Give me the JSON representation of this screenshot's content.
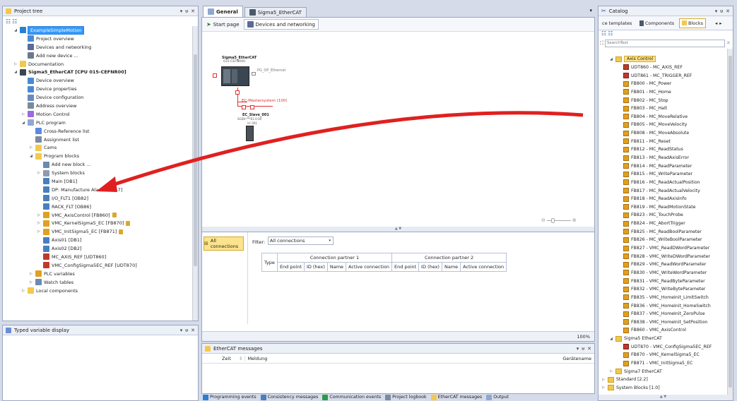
{
  "project_tree": {
    "title": "Project tree",
    "items": [
      {
        "label": "ExampleSimpleMotion",
        "level": 1,
        "icon": "project-icon",
        "selected": true,
        "arrow": "▲"
      },
      {
        "label": "Project overview",
        "level": 2,
        "icon": "overview-icon"
      },
      {
        "label": "Devices and networking",
        "level": 2,
        "icon": "network-icon"
      },
      {
        "label": "Add new device ...",
        "level": 2,
        "icon": "add-device-icon"
      },
      {
        "label": "Documentation",
        "level": 1,
        "icon": "documentation-icon",
        "arrow": "▷"
      },
      {
        "label": "Sigma5_EtherCAT [CPU 015-CEFNR00]",
        "level": 1,
        "icon": "cpu-icon",
        "bold": true,
        "arrow": "▲"
      },
      {
        "label": "Device overview",
        "level": 2,
        "icon": "overview-icon"
      },
      {
        "label": "Device properties",
        "level": 2,
        "icon": "properties-icon"
      },
      {
        "label": "Device configuration",
        "level": 2,
        "icon": "configuration-icon"
      },
      {
        "label": "Address overview",
        "level": 2,
        "icon": "address-icon"
      },
      {
        "label": "Motion Control",
        "level": 2,
        "icon": "motion-icon",
        "arrow": "▷"
      },
      {
        "label": "PLC program",
        "level": 2,
        "icon": "program-icon",
        "arrow": "▲"
      },
      {
        "label": "Cross-Reference list",
        "level": 3,
        "icon": "crossref-icon"
      },
      {
        "label": "Assignment list",
        "level": 3,
        "icon": "list-icon"
      },
      {
        "label": "Cams",
        "level": 3,
        "icon": "cams-icon",
        "arrow": "▷"
      },
      {
        "label": "Program blocks",
        "level": 3,
        "icon": "folder-icon",
        "arrow": "▲"
      },
      {
        "label": "Add new block ...",
        "level": 4,
        "icon": "add-block-icon"
      },
      {
        "label": "System blocks",
        "level": 4,
        "icon": "system-blocks-icon",
        "arrow": "▷"
      },
      {
        "label": "Main [OB1]",
        "level": 4,
        "icon": "ob-icon"
      },
      {
        "label": "DP: Manufacture Alarm [OB57]",
        "level": 4,
        "icon": "ob-icon"
      },
      {
        "label": "I/O_FLT1 [OB82]",
        "level": 4,
        "icon": "ob-icon"
      },
      {
        "label": "RACK_FLT [OB86]",
        "level": 4,
        "icon": "ob-icon"
      },
      {
        "label": "VMC_AxisControl [FB860]",
        "level": 4,
        "icon": "fb-icon",
        "arrow": "▷",
        "lock": true
      },
      {
        "label": "VMC_KernelSigma5_EC [FB870]",
        "level": 4,
        "icon": "fb-icon",
        "arrow": "▷",
        "lock": true
      },
      {
        "label": "VMC_InitSigma5_EC [FB871]",
        "level": 4,
        "icon": "fb-icon",
        "arrow": "▷",
        "lock": true
      },
      {
        "label": "Axis01 [DB1]",
        "level": 4,
        "icon": "db-icon"
      },
      {
        "label": "Axis02 [DB2]",
        "level": 4,
        "icon": "db-icon"
      },
      {
        "label": "MC_AXIS_REF [UDT860]",
        "level": 4,
        "icon": "udt-icon"
      },
      {
        "label": "VMC_ConfigSigma5EC_REF [UDT870]",
        "level": 4,
        "icon": "udt-icon"
      },
      {
        "label": "PLC variables",
        "level": 3,
        "icon": "variables-icon",
        "arrow": "▷"
      },
      {
        "label": "Watch tables",
        "level": 3,
        "icon": "watch-icon",
        "arrow": "▷"
      },
      {
        "label": "Local components",
        "level": 2,
        "icon": "folder-icon",
        "arrow": "▷"
      }
    ]
  },
  "typed_variable": {
    "title": "Typed variable display"
  },
  "editor": {
    "tabs": [
      {
        "label": "General",
        "active": true,
        "icon": "general-icon"
      },
      {
        "label": "Sigma5_EtherCAT",
        "active": false,
        "icon": "device-tab-icon"
      }
    ],
    "subtabs": [
      {
        "label": "Start page",
        "icon": "start-icon"
      },
      {
        "label": "Devices and networking",
        "icon": "network-icon"
      }
    ],
    "device": {
      "name": "Sigma5_EtherCAT",
      "cpu": "015-CEFNR00",
      "port": "PG_OP_Ethernet"
    },
    "master": "EC-Mastersystem (100)",
    "slave": {
      "name": "EC_Slave_001",
      "type": "SGDV-***E1-0-00",
      "id": "id: 001"
    }
  },
  "connections": {
    "button": "All connections",
    "filter_label": "Filter:",
    "filter_value": "All connections",
    "type_header": "Type",
    "partner1": "Connection partner 1",
    "partner2": "Connection partner 2",
    "columns": [
      "End point",
      "ID (hex)",
      "Name",
      "Active connection",
      "End point",
      "ID (hex)",
      "Name",
      "Active connection"
    ],
    "zoom": "100%"
  },
  "ethercat": {
    "title": "EtherCAT messages",
    "col_time": "Zeit",
    "col_message": "Meldung",
    "col_device": "Gerätename"
  },
  "bottom_tabs": [
    {
      "label": "Programming events",
      "icon": "programming-events-icon"
    },
    {
      "label": "Consistency messages",
      "icon": "consistency-icon"
    },
    {
      "label": "Communication events",
      "icon": "communication-icon"
    },
    {
      "label": "Project logbook",
      "icon": "logbook-icon"
    },
    {
      "label": "EtherCAT messages",
      "icon": "ethercat-icon"
    },
    {
      "label": "Output",
      "icon": "output-icon"
    }
  ],
  "catalog": {
    "title": "Catalog",
    "tabs": [
      {
        "label": "ce templates",
        "active": false
      },
      {
        "label": "Components",
        "active": false
      },
      {
        "label": "Blocks",
        "active": true
      }
    ],
    "search_placeholder": "SearchText",
    "items": [
      {
        "label": "Axis Control",
        "level": 1,
        "type": "folder",
        "selected": true,
        "arrow": "▲"
      },
      {
        "label": "UDT860 - MC_AXIS_REF",
        "level": 2,
        "type": "udt"
      },
      {
        "label": "UDT861 - MC_TRIGGER_REF",
        "level": 2,
        "type": "udt"
      },
      {
        "label": "FB800 - MC_Power",
        "level": 2,
        "type": "fb"
      },
      {
        "label": "FB801 - MC_Home",
        "level": 2,
        "type": "fb"
      },
      {
        "label": "FB802 - MC_Stop",
        "level": 2,
        "type": "fb"
      },
      {
        "label": "FB803 - MC_Halt",
        "level": 2,
        "type": "fb"
      },
      {
        "label": "FB804 - MC_MoveRelative",
        "level": 2,
        "type": "fb"
      },
      {
        "label": "FB805 - MC_MoveVelocity",
        "level": 2,
        "type": "fb"
      },
      {
        "label": "FB808 - MC_MoveAbsolute",
        "level": 2,
        "type": "fb"
      },
      {
        "label": "FB811 - MC_Reset",
        "level": 2,
        "type": "fb"
      },
      {
        "label": "FB812 - MC_ReadStatus",
        "level": 2,
        "type": "fb"
      },
      {
        "label": "FB813 - MC_ReadAxisError",
        "level": 2,
        "type": "fb"
      },
      {
        "label": "FB814 - MC_ReadParameter",
        "level": 2,
        "type": "fb"
      },
      {
        "label": "FB815 - MC_WriteParameter",
        "level": 2,
        "type": "fb"
      },
      {
        "label": "FB816 - MC_ReadActualPosition",
        "level": 2,
        "type": "fb"
      },
      {
        "label": "FB817 - MC_ReadActualVelocity",
        "level": 2,
        "type": "fb"
      },
      {
        "label": "FB818 - MC_ReadAxisInfo",
        "level": 2,
        "type": "fb"
      },
      {
        "label": "FB819 - MC_ReadMotionState",
        "level": 2,
        "type": "fb"
      },
      {
        "label": "FB823 - MC_TouchProbe",
        "level": 2,
        "type": "fb"
      },
      {
        "label": "FB824 - MC_AbortTrigger",
        "level": 2,
        "type": "fb"
      },
      {
        "label": "FB825 - MC_ReadBoolParameter",
        "level": 2,
        "type": "fb"
      },
      {
        "label": "FB826 - MC_WriteBoolParameter",
        "level": 2,
        "type": "fb"
      },
      {
        "label": "FB827 - VMC_ReadDWordParameter",
        "level": 2,
        "type": "fb"
      },
      {
        "label": "FB828 - VMC_WriteDWordParameter",
        "level": 2,
        "type": "fb"
      },
      {
        "label": "FB829 - VMC_ReadWordParameter",
        "level": 2,
        "type": "fb"
      },
      {
        "label": "FB830 - VMC_WriteWordParameter",
        "level": 2,
        "type": "fb"
      },
      {
        "label": "FB831 - VMC_ReadByteParameter",
        "level": 2,
        "type": "fb"
      },
      {
        "label": "FB832 - VMC_WriteByteParameter",
        "level": 2,
        "type": "fb"
      },
      {
        "label": "FB835 - VMC_HomeInit_LimitSwitch",
        "level": 2,
        "type": "fb"
      },
      {
        "label": "FB836 - VMC_HomeInit_HomeSwitch",
        "level": 2,
        "type": "fb"
      },
      {
        "label": "FB837 - VMC_HomeInit_ZeroPulse",
        "level": 2,
        "type": "fb"
      },
      {
        "label": "FB838 - VMC_HomeInit_SetPosition",
        "level": 2,
        "type": "fb"
      },
      {
        "label": "FB860 - VMC_AxisControl",
        "level": 2,
        "type": "fb"
      },
      {
        "label": "Sigma5 EtherCAT",
        "level": 1,
        "type": "folder",
        "arrow": "▲"
      },
      {
        "label": "UDT870 - VMC_ConfigSigma5EC_REF",
        "level": 2,
        "type": "udt"
      },
      {
        "label": "FB870 - VMC_KernelSigma5_EC",
        "level": 2,
        "type": "fb"
      },
      {
        "label": "FB871 - VMC_InitSigma5_EC",
        "level": 2,
        "type": "fb"
      },
      {
        "label": "Sigma7 EtherCAT",
        "level": 1,
        "type": "folder",
        "arrow": "▷"
      },
      {
        "label": "Standard [2.2]",
        "level": 0,
        "type": "folder",
        "arrow": "▷"
      },
      {
        "label": "System Blocks [1.0]",
        "level": 0,
        "type": "folder",
        "arrow": "▷"
      }
    ]
  },
  "colors": {
    "accent": "#3399ff",
    "annotation_arrow": "#e02020",
    "network_red": "#e03030"
  }
}
